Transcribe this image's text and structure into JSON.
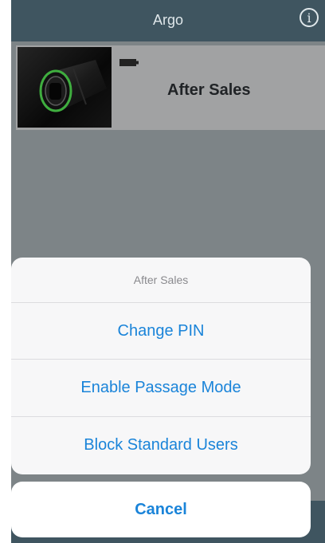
{
  "navbar": {
    "title": "Argo",
    "info_icon": "info-circle-icon"
  },
  "device": {
    "name": "After Sales",
    "battery_icon": "battery-icon"
  },
  "action_sheet": {
    "title": "After Sales",
    "actions": [
      {
        "label": "Change PIN"
      },
      {
        "label": "Enable Passage Mode"
      },
      {
        "label": "Block Standard Users"
      }
    ],
    "cancel_label": "Cancel"
  },
  "colors": {
    "navbar": "#3f5560",
    "overlay": "#7d8487",
    "action_blue": "#1a84d9",
    "sheet_bg": "#f7f7f8"
  }
}
